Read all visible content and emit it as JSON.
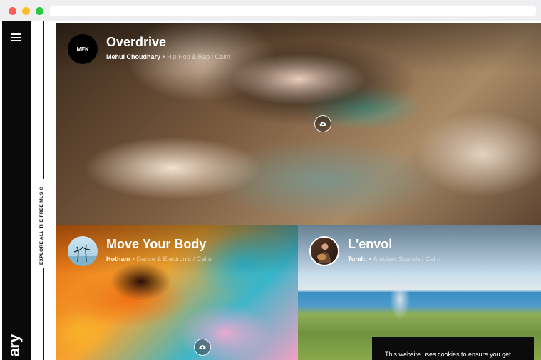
{
  "sidebar": {
    "menu_icon": "hamburger-menu-icon",
    "brand_text": "ary"
  },
  "rail": {
    "label": "EXPLORE ALL THE FREE MUSIC"
  },
  "tracks": [
    {
      "title": "Overdrive",
      "artist": "Mehul Choudhary",
      "genres": "Hip Hop & Rap / Calm",
      "avatar_text": "MEK",
      "icon": "cloud-download-icon"
    },
    {
      "title": "Move Your Body",
      "artist": "Hotham",
      "genres": "Dance & Electronic / Calm",
      "icon": "cloud-download-icon"
    },
    {
      "title": "L'envol",
      "artist": "Tomh.",
      "genres": "Ambient Sounds / Calm",
      "icon": "cloud-download-icon"
    }
  ],
  "cookie": {
    "text": "This website uses cookies to ensure you get"
  },
  "colors": {
    "sidebar": "#0a0a0a",
    "accent": "#ffffff"
  }
}
